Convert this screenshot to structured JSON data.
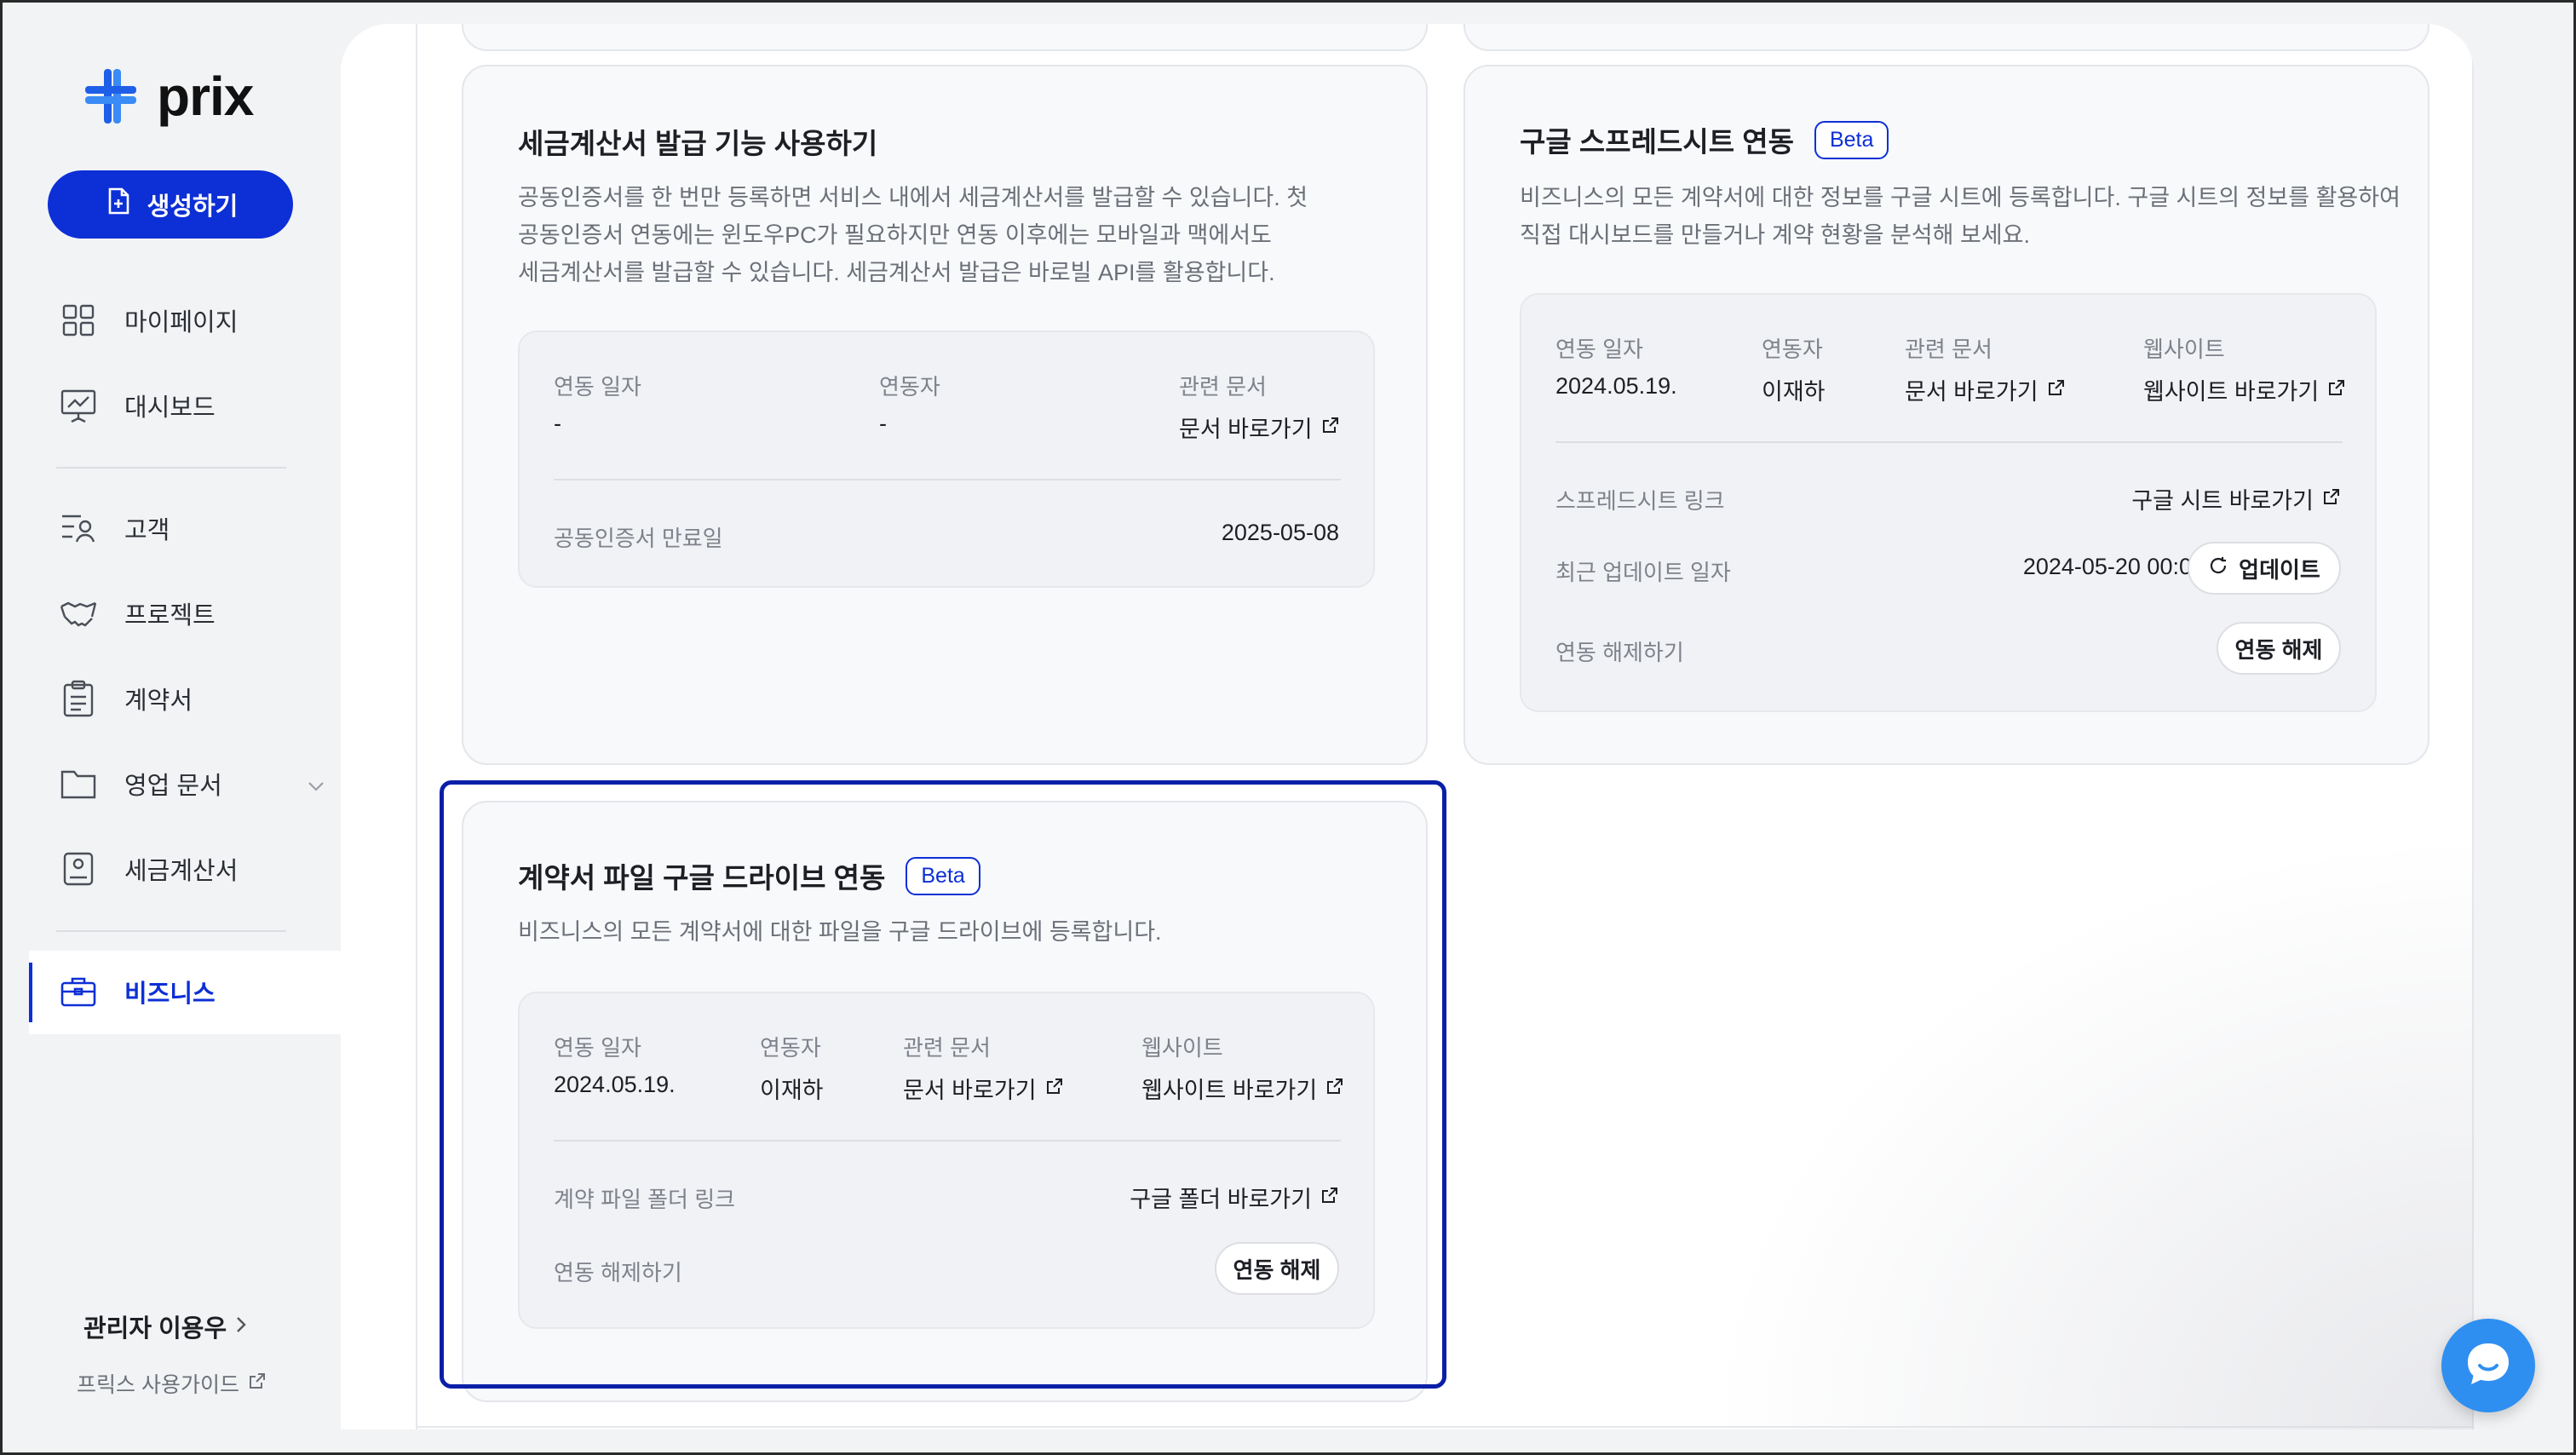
{
  "brand": {
    "name": "prix"
  },
  "sidebar": {
    "create_label": "생성하기",
    "items": [
      {
        "label": "마이페이지",
        "icon": "grid-icon"
      },
      {
        "label": "대시보드",
        "icon": "presentation-chart-icon"
      },
      {
        "label": "고객",
        "icon": "customer-list-icon"
      },
      {
        "label": "프로젝트",
        "icon": "handshake-icon"
      },
      {
        "label": "계약서",
        "icon": "clipboard-icon"
      },
      {
        "label": "영업 문서",
        "icon": "folder-icon"
      },
      {
        "label": "세금계산서",
        "icon": "receipt-icon"
      },
      {
        "label": "비즈니스",
        "icon": "briefcase-icon"
      }
    ],
    "active_item": "비즈니스",
    "admin_label": "관리자 이용우",
    "guide_label": "프릭스 사용가이드"
  },
  "cards": {
    "tax": {
      "title": "세금계산서 발급 기능 사용하기",
      "desc": [
        "공동인증서를 한 번만 등록하면 서비스 내에서 세금계산서를 발급할 수 있습니다. 첫",
        "공동인증서 연동에는 윈도우PC가 필요하지만 연동 이후에는 모바일과 맥에서도",
        "세금계산서를 발급할 수 있습니다. 세금계산서 발급은 바로빌 API를 활용합니다."
      ],
      "labels": {
        "date": "연동 일자",
        "user": "연동자",
        "doc": "관련 문서",
        "cert_expiry": "공동인증서 만료일"
      },
      "values": {
        "date": "-",
        "user": "-",
        "doc": "문서 바로가기",
        "cert_expiry": "2025-05-08"
      }
    },
    "sheet": {
      "title": "구글 스프레드시트 연동",
      "badge": "Beta",
      "desc": [
        "비즈니스의 모든 계약서에 대한 정보를 구글 시트에 등록합니다. 구글 시트의 정보를 활용하여",
        "직접 대시보드를 만들거나 계약 현황을 분석해 보세요."
      ],
      "labels": {
        "date": "연동 일자",
        "user": "연동자",
        "doc": "관련 문서",
        "site": "웹사이트",
        "sheet_link": "스프레드시트 링크",
        "last_update": "최근 업데이트 일자",
        "unlink": "연동 해제하기"
      },
      "values": {
        "date": "2024.05.19.",
        "user": "이재하",
        "doc": "문서 바로가기",
        "site": "웹사이트 바로가기",
        "sheet_link": "구글 시트 바로가기",
        "last_update": "2024-05-20 00:03"
      },
      "update_button": "업데이트",
      "unlink_button": "연동 해제"
    },
    "drive": {
      "title": "계약서 파일 구글 드라이브 연동",
      "badge": "Beta",
      "desc": "비즈니스의 모든 계약서에 대한 파일을 구글 드라이브에 등록합니다.",
      "labels": {
        "date": "연동 일자",
        "user": "연동자",
        "doc": "관련 문서",
        "site": "웹사이트",
        "folder_link": "계약 파일 폴더 링크",
        "unlink": "연동 해제하기"
      },
      "values": {
        "date": "2024.05.19.",
        "user": "이재하",
        "doc": "문서 바로가기",
        "site": "웹사이트 바로가기",
        "folder_link": "구글 폴더 바로가기"
      },
      "unlink_button": "연동 해제"
    }
  },
  "colors": {
    "accent": "#0c2fd6",
    "highlight": "#0a1fa8",
    "chat": "#2f8ff0"
  }
}
